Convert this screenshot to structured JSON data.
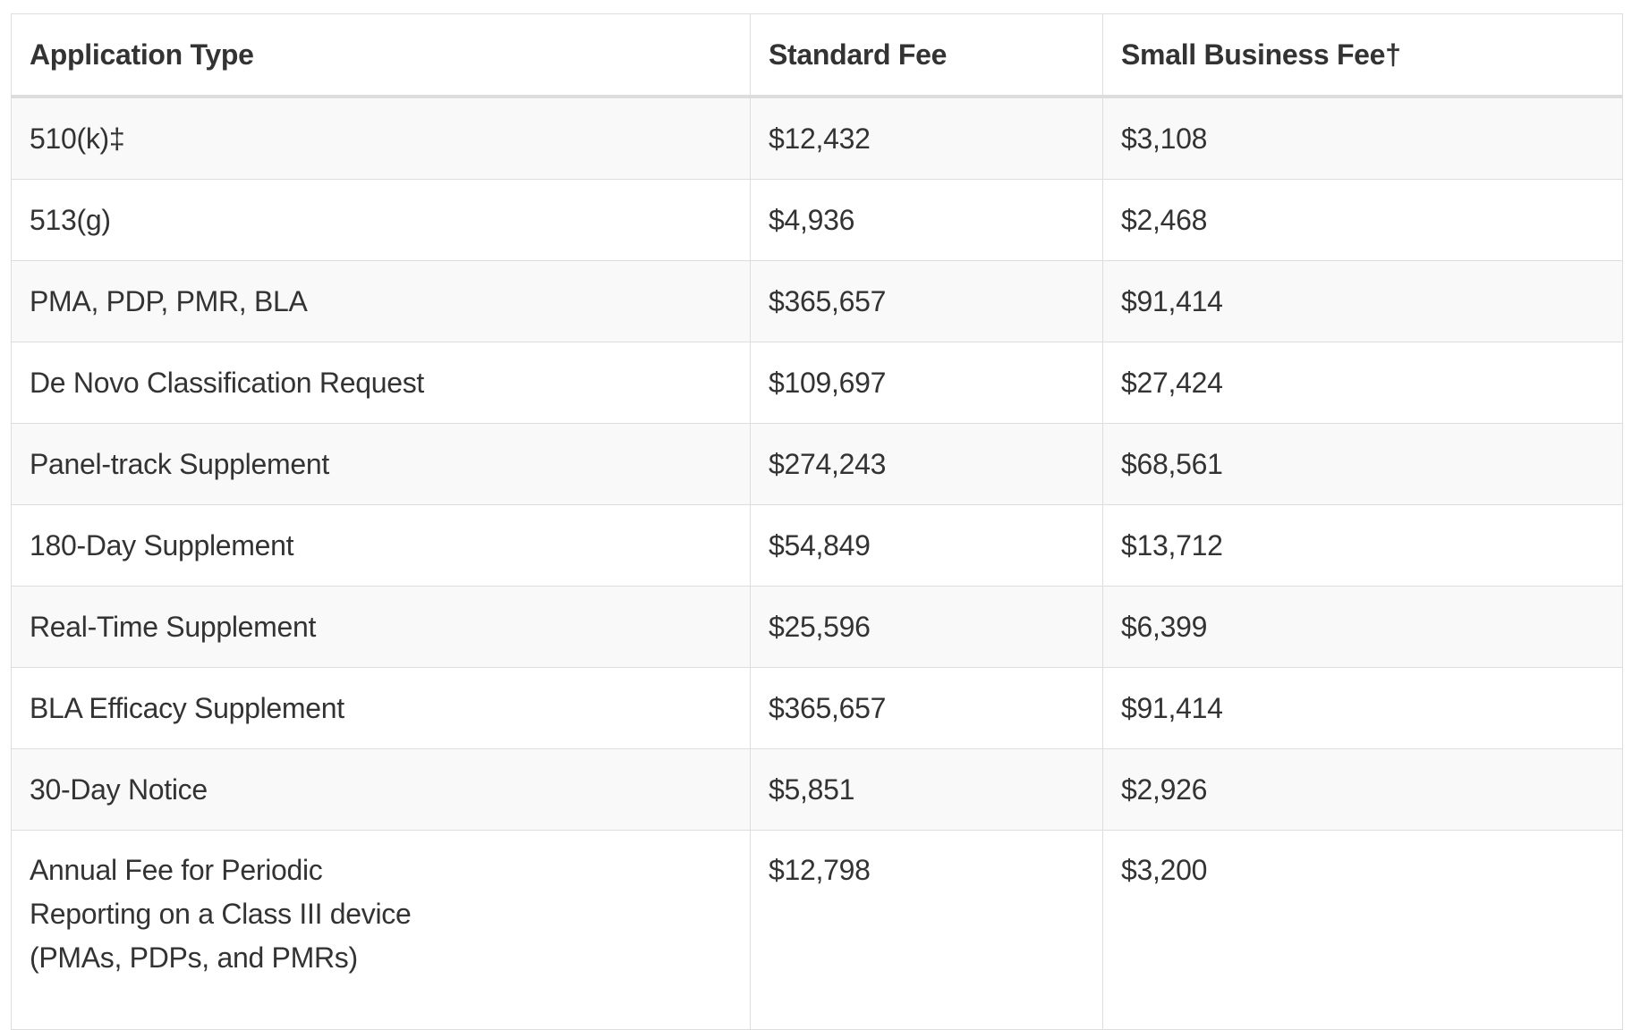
{
  "table": {
    "headers": [
      "Application Type",
      "Standard Fee",
      "Small Business Fee†"
    ],
    "rows": [
      [
        "510(k)‡",
        "$12,432",
        "$3,108"
      ],
      [
        "513(g)",
        "$4,936",
        "$2,468"
      ],
      [
        "PMA, PDP, PMR, BLA",
        "$365,657",
        "$91,414"
      ],
      [
        "De Novo Classification Request",
        "$109,697",
        "$27,424"
      ],
      [
        "Panel-track Supplement",
        "$274,243",
        "$68,561"
      ],
      [
        "180-Day Supplement",
        "$54,849",
        "$13,712"
      ],
      [
        "Real-Time Supplement",
        "$25,596",
        "$6,399"
      ],
      [
        "BLA Efficacy Supplement",
        "$365,657",
        "$91,414"
      ],
      [
        "30-Day Notice",
        "$5,851",
        "$2,926"
      ],
      [
        "Annual Fee for Periodic Reporting on a Class III device (PMAs, PDPs, and PMRs)",
        "$12,798",
        "$3,200"
      ]
    ]
  }
}
